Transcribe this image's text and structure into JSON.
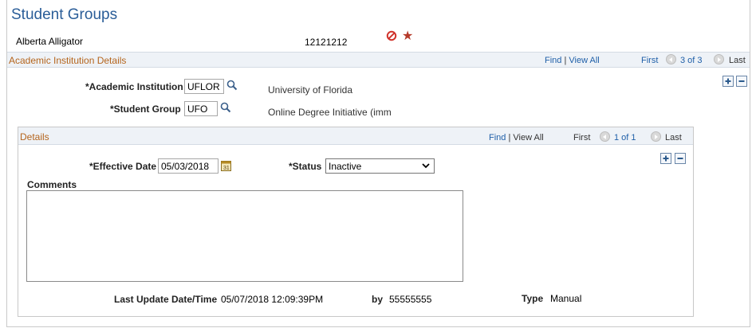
{
  "page": {
    "title": "Student Groups",
    "student_name": "Alberta Alligator",
    "student_id": "12121212",
    "colors": {
      "title": "#2a5d98",
      "section_header": "#b5651d",
      "link": "#1f5fa8",
      "bar_bg": "#eef2f7"
    }
  },
  "institution_section": {
    "header": "Academic Institution Details",
    "find_label": "Find",
    "separator": "|",
    "view_all_label": "View All",
    "first_label": "First",
    "position_label": "3 of 3",
    "last_label": "Last",
    "institution_label": "*Academic Institution",
    "institution_value": "UFLOR",
    "institution_desc": "University of Florida",
    "student_group_label": "*Student Group",
    "student_group_value": "UFO",
    "student_group_desc": "Online Degree Initiative (imm"
  },
  "details_section": {
    "header": "Details",
    "find_label": "Find",
    "separator": "|",
    "view_all_label": "View All",
    "first_label": "First",
    "position_label": "1 of 1",
    "last_label": "Last",
    "effective_date_label": "*Effective Date",
    "effective_date_value": "05/03/2018",
    "status_label": "*Status",
    "status_value": "Inactive",
    "comments_label": "Comments",
    "comments_value": "",
    "last_update_label": "Last Update Date/Time",
    "last_update_value": "05/07/2018 12:09:39PM",
    "by_label": "by",
    "by_value": "55555555",
    "type_label": "Type",
    "type_value": "Manual"
  },
  "icons": {
    "prohibited": "prohibited-icon",
    "star": "star-icon",
    "lookup": "magnifier-icon",
    "calendar": "calendar-icon",
    "add": "plus-icon",
    "remove": "minus-icon",
    "prev": "previous-arrow-icon",
    "next": "next-arrow-icon",
    "dropdown": "chevron-down-icon"
  }
}
